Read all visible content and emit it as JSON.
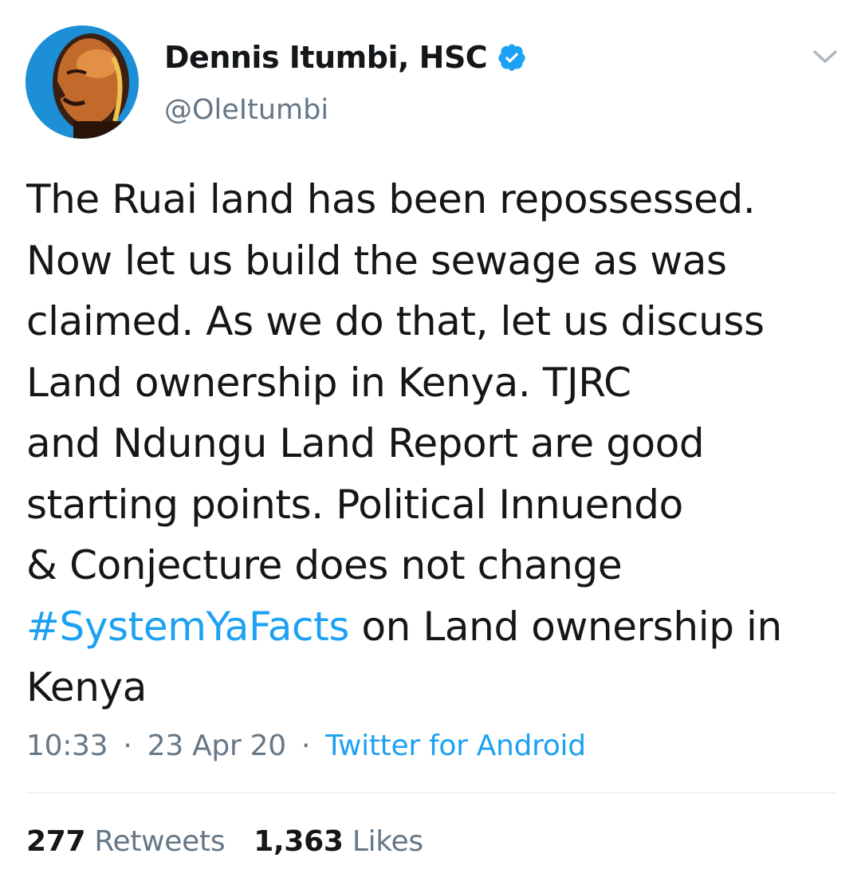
{
  "tweet": {
    "author": {
      "display_name": "Dennis Itumbi, HSC",
      "handle": "@OleItumbi",
      "verified": true,
      "avatar_icon": "user-avatar-portrait"
    },
    "menu_icon": "chevron-down-icon",
    "text": {
      "line_1": "The Ruai land has been repossessed.",
      "line_2": "Now let us build the sewage as was",
      "line_3": "claimed. As we do that, let us discuss",
      "line_4": "Land ownership in Kenya. TJRC",
      "line_5": "and Ndungu Land Report are good",
      "line_6": "starting points. Political Innuendo",
      "line_7": "& Conjecture does not change",
      "line_8_hashtag": "#SystemYaFacts",
      "line_8_rest": " on Land ownership in",
      "line_9": "Kenya"
    },
    "meta": {
      "time": "10:33",
      "date": "23 Apr 20",
      "separator": "·",
      "source": "Twitter for Android"
    },
    "stats": {
      "retweets_count": "277",
      "retweets_label": "Retweets",
      "likes_count": "1,363",
      "likes_label": "Likes"
    },
    "colors": {
      "link": "#1da1f2",
      "secondary_text": "#657786",
      "primary_text": "#14171a",
      "divider": "#e1e8ed"
    }
  }
}
